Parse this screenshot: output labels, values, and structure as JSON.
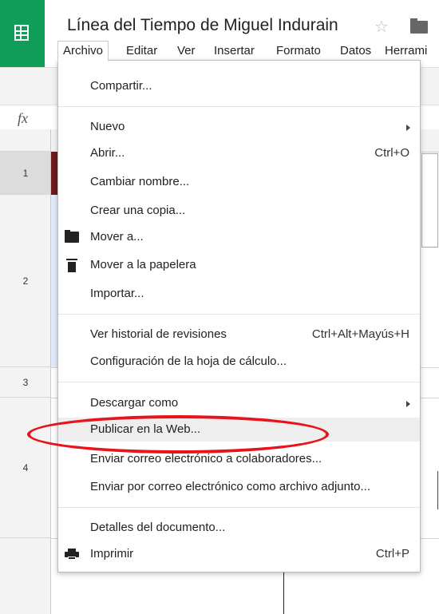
{
  "app": {
    "title": "Línea del Tiempo de Miguel Indurain",
    "star_icon": "☆",
    "formula_icon": "fx"
  },
  "menubar": {
    "items": [
      "Archivo",
      "Editar",
      "Ver",
      "Insertar",
      "Formato",
      "Datos",
      "Herrami"
    ],
    "active": "Archivo"
  },
  "grid": {
    "rows": [
      "1",
      "2",
      "3",
      "4"
    ]
  },
  "file_menu": {
    "items": [
      {
        "label": "Compartir..."
      },
      {
        "label": "Nuevo",
        "submenu": true
      },
      {
        "label": "Abrir...",
        "shortcut": "Ctrl+O"
      },
      {
        "label": "Cambiar nombre..."
      },
      {
        "label": "Crear una copia..."
      },
      {
        "label": "Mover a...",
        "icon": "folder-icon"
      },
      {
        "label": "Mover a la papelera",
        "icon": "trash-icon"
      },
      {
        "label": "Importar..."
      },
      {
        "label": "Ver historial de revisiones",
        "shortcut": "Ctrl+Alt+Mayús+H"
      },
      {
        "label": "Configuración de la hoja de cálculo..."
      },
      {
        "label": "Descargar como",
        "submenu": true
      },
      {
        "label": "Publicar en la Web...",
        "highlighted": true
      },
      {
        "label": "Enviar correo electrónico a colaboradores..."
      },
      {
        "label": "Enviar por correo electrónico como archivo adjunto..."
      },
      {
        "label": "Detalles del documento..."
      },
      {
        "label": "Imprimir",
        "shortcut": "Ctrl+P",
        "icon": "printer-icon"
      }
    ]
  },
  "annotation": {
    "color": "#e8141b",
    "target": "Publicar en la Web..."
  },
  "colors": {
    "brand": "#0f9d58",
    "highlight": "#eeeeee"
  }
}
